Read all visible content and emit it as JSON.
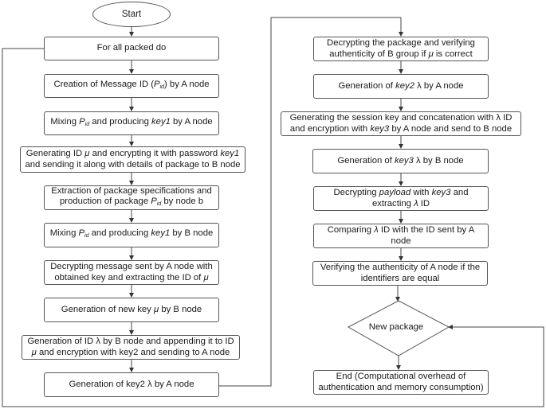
{
  "diagram": {
    "start": "Start",
    "left_column": [
      {
        "id": "L1",
        "text": "For all packed do"
      },
      {
        "id": "L2",
        "parts": [
          "Creation of Message ID (",
          "P",
          "id",
          ") by A node"
        ]
      },
      {
        "id": "L3",
        "parts": [
          "Mixing ",
          "P",
          "id",
          " and producing ",
          "key1",
          " by A node"
        ]
      },
      {
        "id": "L4",
        "line1": [
          "Generating ID ",
          "μ",
          " and encrypting it with password ",
          "key1"
        ],
        "line2": "and sending it along with details of package to B node"
      },
      {
        "id": "L5",
        "line1": "Extraction of package specifications and",
        "line2": [
          "production of package ",
          "P",
          "id",
          " by node b"
        ]
      },
      {
        "id": "L6",
        "parts": [
          "Mixing ",
          "P",
          "id",
          " and producing ",
          "key1",
          " by B node"
        ]
      },
      {
        "id": "L7",
        "line1": "Decrypting message sent by A node with",
        "line2": [
          "obtained key and extracting the ID of ",
          "μ"
        ]
      },
      {
        "id": "L8",
        "parts": [
          "Generation of new key ",
          "μ",
          " by B node"
        ]
      },
      {
        "id": "L9",
        "line1": "Generation of ID λ by B node and appending it to ID",
        "line2": [
          "μ",
          " and encryption with key2 and sending to A node"
        ]
      },
      {
        "id": "L10",
        "text": "Generation of key2 λ by A node"
      }
    ],
    "right_column": [
      {
        "id": "R1",
        "line1": "Decrypting the package and verifying",
        "line2": [
          "authenticity of B group if ",
          "μ",
          " is correct"
        ]
      },
      {
        "id": "R2",
        "parts": [
          "Generation of ",
          "key2",
          " λ by A node"
        ]
      },
      {
        "id": "R3",
        "line1": "Generating the session key and concatenation with λ ID",
        "line2": [
          "and encryption with ",
          "key3",
          " by A node and send to B node"
        ]
      },
      {
        "id": "R4",
        "parts": [
          "Generation of ",
          "key3",
          " λ by B node"
        ]
      },
      {
        "id": "R5",
        "line1": [
          "Decrypting ",
          "payload",
          " with ",
          "key3",
          " and"
        ],
        "line2": [
          "extracting ",
          "λ",
          " ID"
        ]
      },
      {
        "id": "R6",
        "line1": [
          "Comparing ",
          "λ",
          " ID with the ID sent by A"
        ],
        "line2": "node"
      },
      {
        "id": "R7",
        "line1": "Verifying the authenticity of A node if the",
        "line2": "identifiers are equal"
      },
      {
        "id": "decision",
        "text": "New package"
      },
      {
        "id": "R8",
        "line1": "End (Computational overhead of",
        "line2": "authentication and memory consumption)"
      }
    ]
  }
}
